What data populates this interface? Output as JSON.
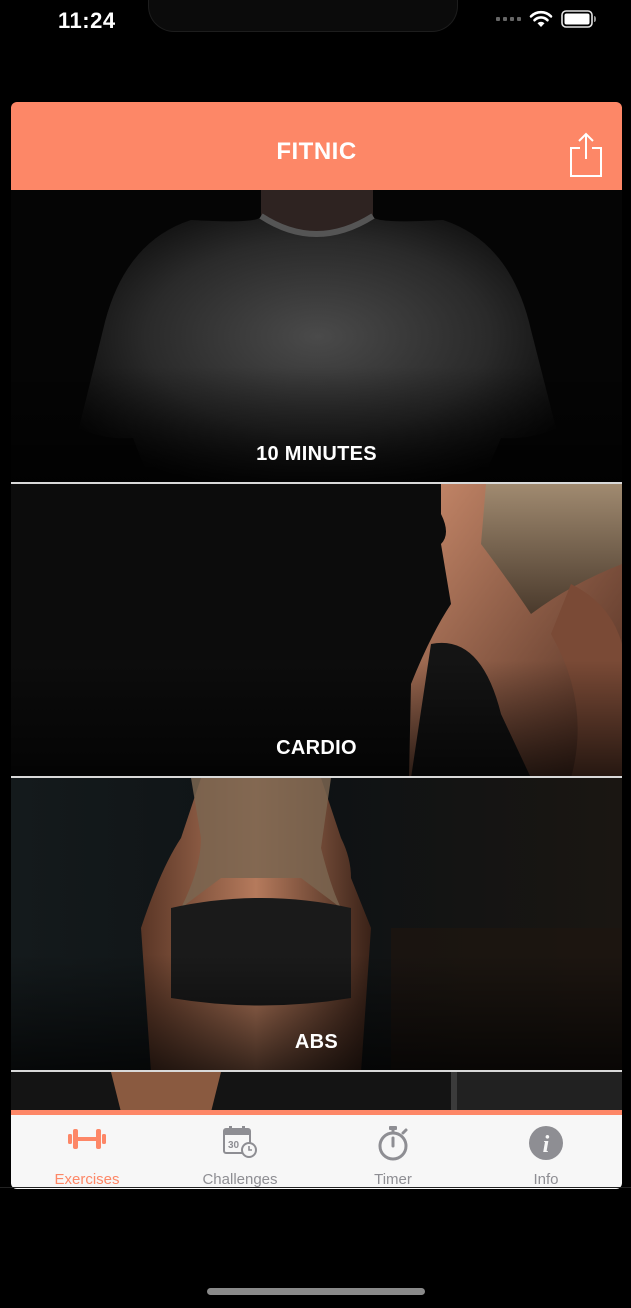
{
  "status_bar": {
    "time": "11:24"
  },
  "app": {
    "title": "FITNIC",
    "share_icon": "share-icon"
  },
  "workouts": [
    {
      "label": "10 MINUTES",
      "image": "man-gray-tshirt-photo"
    },
    {
      "label": "CARDIO",
      "image": "woman-side-profile-photo"
    },
    {
      "label": "ABS",
      "image": "woman-sports-bra-photo"
    }
  ],
  "tabs": [
    {
      "label": "Exercises",
      "icon": "dumbbell-icon",
      "active": true
    },
    {
      "label": "Challenges",
      "icon": "calendar-30-icon",
      "active": false
    },
    {
      "label": "Timer",
      "icon": "stopwatch-icon",
      "active": false
    },
    {
      "label": "Info",
      "icon": "info-icon",
      "active": false
    }
  ],
  "colors": {
    "accent": "#fd8767",
    "tab_inactive": "#8e8e93",
    "tab_bar_bg": "#f7f7f7"
  },
  "calendar_icon_number": "30",
  "info_icon_glyph": "i"
}
